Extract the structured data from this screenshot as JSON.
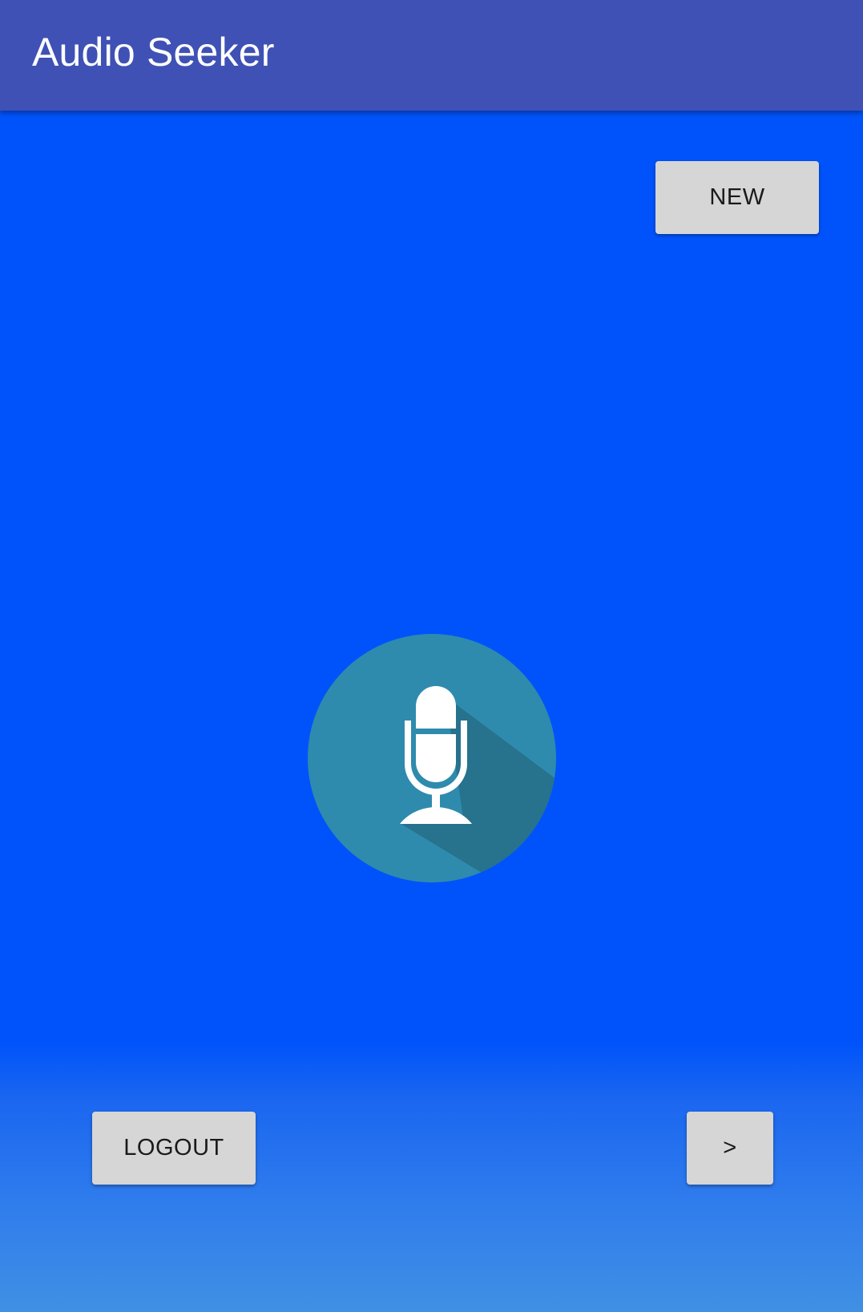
{
  "app_bar": {
    "title": "Audio Seeker"
  },
  "buttons": {
    "new_label": "NEW",
    "logout_label": "LOGOUT",
    "next_label": ">"
  },
  "record": {
    "icon": "microphone-icon"
  },
  "colors": {
    "app_bar": "#3f51b5",
    "background": "#0053fb",
    "background_bottom": "#4090e4",
    "button": "#d6d6d6",
    "mic_circle": "#2e8bad",
    "mic_shadow": "#27728d"
  }
}
